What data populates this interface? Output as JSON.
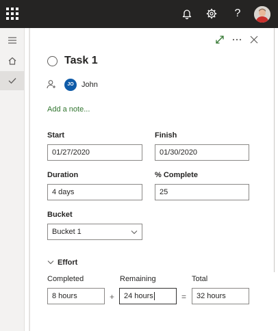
{
  "task": {
    "title": "Task 1",
    "assignee_initials": "JO",
    "assignee_name": "John",
    "add_note": "Add a note..."
  },
  "dates": {
    "start_label": "Start",
    "start_value": "01/27/2020",
    "finish_label": "Finish",
    "finish_value": "01/30/2020"
  },
  "progress": {
    "duration_label": "Duration",
    "duration_value": "4 days",
    "complete_label": "% Complete",
    "complete_value": "25"
  },
  "bucket": {
    "label": "Bucket",
    "value": "Bucket 1"
  },
  "effort": {
    "header": "Effort",
    "completed_label": "Completed",
    "completed_value": "8 hours",
    "remaining_label": "Remaining",
    "remaining_value": "24 hours",
    "total_label": "Total",
    "total_value": "32 hours",
    "plus": "+",
    "equals": "="
  },
  "icons": {
    "app_launcher": "waffle-icon",
    "notifications": "bell-icon",
    "settings": "gear-icon",
    "help": "?",
    "nav_toggle": "hamburger-icon",
    "home": "home-icon",
    "tasks": "checkmark-icon",
    "expand": "expand-icon",
    "more": "more-icon",
    "close": "close-icon"
  },
  "colors": {
    "topbar": "#252423",
    "accent_green": "#31752f",
    "avatar_blue": "#0f5ba8"
  }
}
